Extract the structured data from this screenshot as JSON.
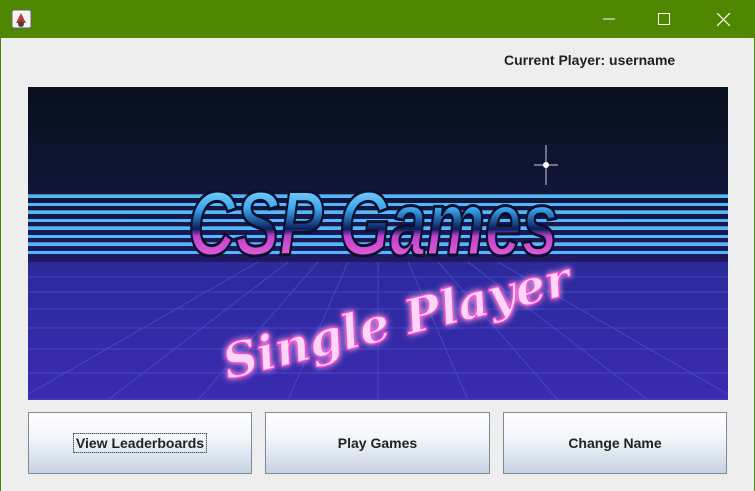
{
  "window": {
    "title_bar_color": "#4f8700",
    "icons": [
      "java-app-icon",
      "minimize-icon",
      "maximize-icon",
      "close-icon"
    ]
  },
  "header": {
    "current_player_label": "Current Player: username"
  },
  "banner": {
    "title": "CSP Games",
    "subtitle": "Single Player"
  },
  "buttons": {
    "leaderboards": "View Leaderboards",
    "play": "Play Games",
    "change_name": "Change Name"
  }
}
